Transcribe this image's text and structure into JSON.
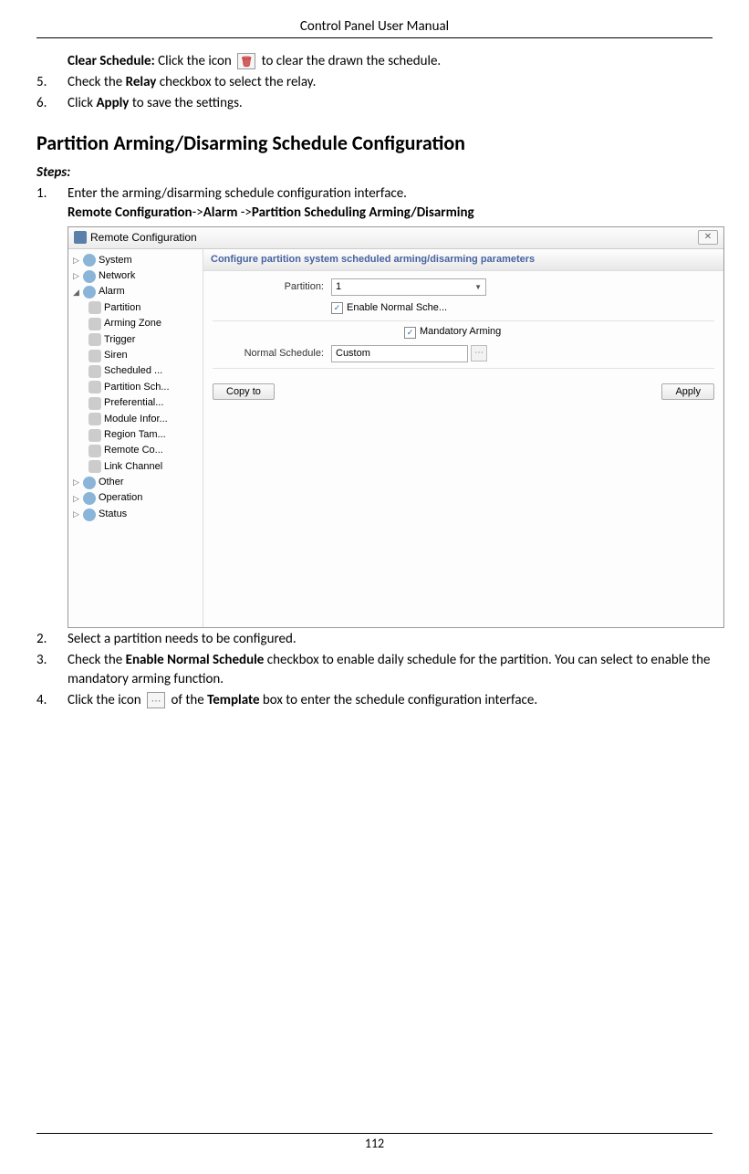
{
  "header": {
    "title": "Control Panel User Manual"
  },
  "footer": {
    "page": "112"
  },
  "text": {
    "clear_bold": "Clear Schedule:",
    "clear_rest_a": " Click the icon ",
    "clear_rest_b": " to clear the drawn the schedule.",
    "step5_num": "5.",
    "step5_a": "Check the ",
    "step5_bold": "Relay",
    "step5_b": " checkbox to select the relay.",
    "step6_num": "6.",
    "step6_a": "Click ",
    "step6_bold": "Apply",
    "step6_b": " to save the settings.",
    "section": "Partition Arming/Disarming Schedule Configuration",
    "steps_label": "Steps:",
    "p1_num": "1.",
    "p1_line1": "Enter the arming/disarming schedule configuration interface.",
    "p1_bold1": "Remote Configuration",
    "p1_sep1": "->",
    "p1_bold2": "Alarm",
    "p1_sep2": " ->",
    "p1_bold3": "Partition Scheduling Arming/Disarming",
    "p2_num": "2.",
    "p2_text": "Select a partition needs to be configured.",
    "p3_num": "3.",
    "p3_a": "Check the ",
    "p3_bold": "Enable Normal Schedule",
    "p3_b": " checkbox to enable daily schedule for the partition. You can select to enable the mandatory arming function.",
    "p4_num": "4.",
    "p4_a": "Click the icon ",
    "p4_b": " of the ",
    "p4_bold": "Template",
    "p4_c": " box to enter the schedule configuration interface."
  },
  "window": {
    "title": "Remote Configuration",
    "close": "✕",
    "tree": {
      "system": "System",
      "network": "Network",
      "alarm": "Alarm",
      "partition": "Partition",
      "arming_zone": "Arming Zone",
      "trigger": "Trigger",
      "siren": "Siren",
      "scheduled": "Scheduled ...",
      "partition_sch": "Partition Sch...",
      "preferential": "Preferential...",
      "module_infor": "Module Infor...",
      "region_tam": "Region Tam...",
      "remote_co": "Remote Co...",
      "link_channel": "Link Channel",
      "other": "Other",
      "operation": "Operation",
      "status": "Status"
    },
    "panel_header": "Configure partition system scheduled arming/disarming parameters",
    "form": {
      "partition_label": "Partition:",
      "partition_value": "1",
      "enable_normal_label": "Enable Normal Sche...",
      "mandatory_label": "Mandatory Arming",
      "normal_schedule_label": "Normal Schedule:",
      "normal_schedule_value": "Custom",
      "copy_to": "Copy to",
      "apply": "Apply"
    }
  }
}
